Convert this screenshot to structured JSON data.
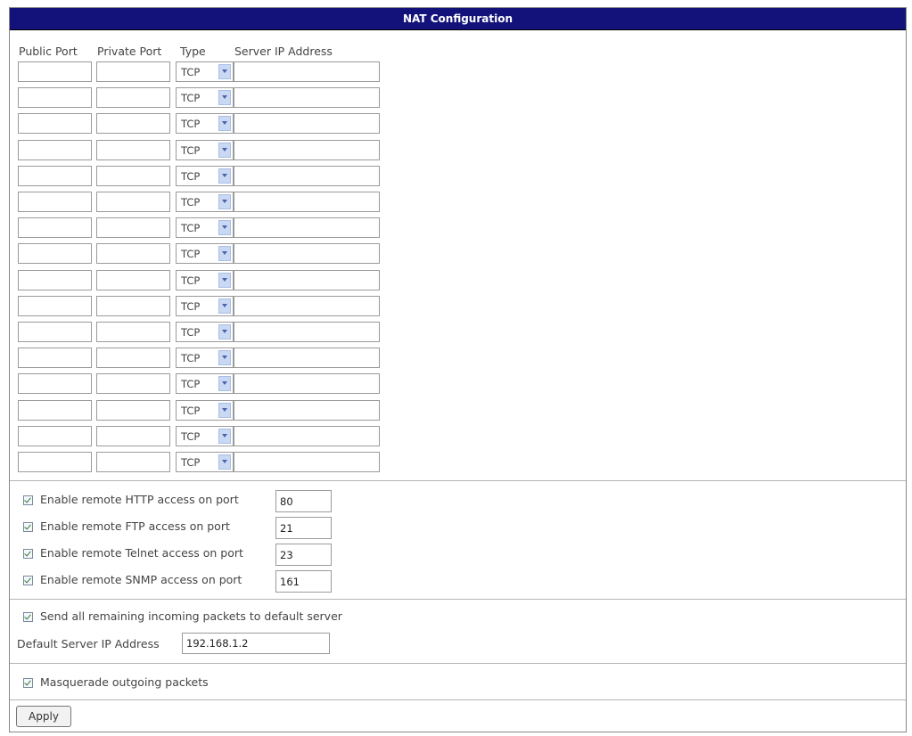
{
  "title": "NAT Configuration",
  "columns": {
    "public_port": "Public Port",
    "private_port": "Private Port",
    "type": "Type",
    "server_ip": "Server IP Address"
  },
  "rows": [
    {
      "public_port": "",
      "private_port": "",
      "type": "TCP",
      "server_ip": ""
    },
    {
      "public_port": "",
      "private_port": "",
      "type": "TCP",
      "server_ip": ""
    },
    {
      "public_port": "",
      "private_port": "",
      "type": "TCP",
      "server_ip": ""
    },
    {
      "public_port": "",
      "private_port": "",
      "type": "TCP",
      "server_ip": ""
    },
    {
      "public_port": "",
      "private_port": "",
      "type": "TCP",
      "server_ip": ""
    },
    {
      "public_port": "",
      "private_port": "",
      "type": "TCP",
      "server_ip": ""
    },
    {
      "public_port": "",
      "private_port": "",
      "type": "TCP",
      "server_ip": ""
    },
    {
      "public_port": "",
      "private_port": "",
      "type": "TCP",
      "server_ip": ""
    },
    {
      "public_port": "",
      "private_port": "",
      "type": "TCP",
      "server_ip": ""
    },
    {
      "public_port": "",
      "private_port": "",
      "type": "TCP",
      "server_ip": ""
    },
    {
      "public_port": "",
      "private_port": "",
      "type": "TCP",
      "server_ip": ""
    },
    {
      "public_port": "",
      "private_port": "",
      "type": "TCP",
      "server_ip": ""
    },
    {
      "public_port": "",
      "private_port": "",
      "type": "TCP",
      "server_ip": ""
    },
    {
      "public_port": "",
      "private_port": "",
      "type": "TCP",
      "server_ip": ""
    },
    {
      "public_port": "",
      "private_port": "",
      "type": "TCP",
      "server_ip": ""
    },
    {
      "public_port": "",
      "private_port": "",
      "type": "TCP",
      "server_ip": ""
    }
  ],
  "remote_access": [
    {
      "label": "Enable remote HTTP access on port",
      "checked": true,
      "port": "80"
    },
    {
      "label": "Enable remote FTP access on port",
      "checked": true,
      "port": "21"
    },
    {
      "label": "Enable remote Telnet access on port",
      "checked": true,
      "port": "23"
    },
    {
      "label": "Enable remote SNMP access on port",
      "checked": true,
      "port": "161"
    }
  ],
  "default_server": {
    "send_label": "Send all remaining incoming packets to default server",
    "send_checked": true,
    "ip_label": "Default Server IP Address",
    "ip_value": "192.168.1.2"
  },
  "masquerade": {
    "label": "Masquerade outgoing packets",
    "checked": true
  },
  "apply_label": "Apply",
  "colors": {
    "title_bar": "#13127a",
    "title_text": "#ffffff",
    "select_button": "#c9d8f3",
    "check_mark": "#2d7a2d"
  },
  "icons": {
    "dropdown": "chevron-down-icon",
    "checkbox": "checkmark-icon"
  }
}
